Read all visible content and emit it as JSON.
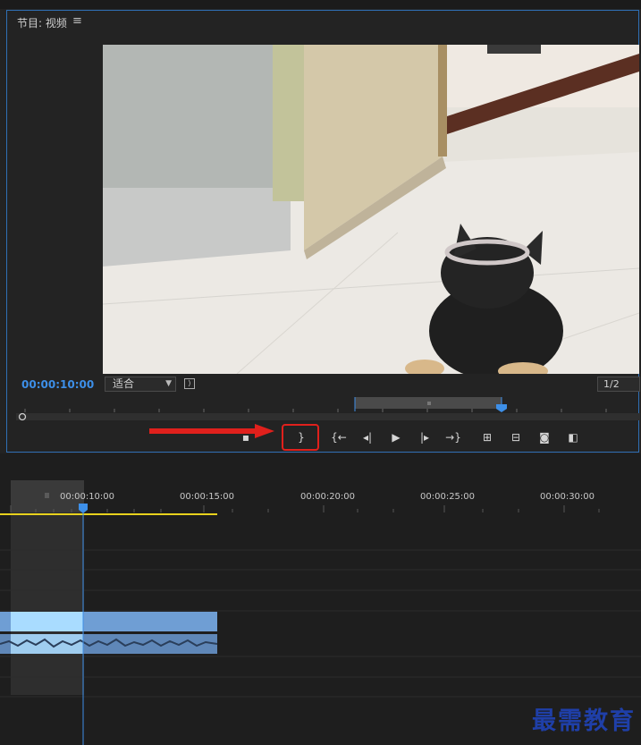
{
  "monitor": {
    "title": "节目: 视频",
    "menu_glyph": "≡",
    "timecode": "00:00:10:00",
    "fit_label": "适合",
    "resolution": "1/2"
  },
  "timeline": {
    "ruler_labels": [
      "00:00:10:00",
      "00:00:15:00",
      "00:00:20:00",
      "00:00:25:00",
      "00:00:30:00"
    ]
  },
  "controls": {
    "icons": [
      "mark-in-icon",
      "mark-out-icon",
      "go-to-in-icon",
      "step-back-icon",
      "play-icon",
      "step-forward-icon",
      "go-to-out-icon",
      "lift-icon",
      "extract-icon",
      "export-frame-icon",
      "compare-view-icon"
    ]
  },
  "colors": {
    "accent_blue": "#3d8fe8",
    "highlight_red": "#e0201c",
    "work_area_yellow": "#e8d21d",
    "clip_video": "#6f9ed4",
    "clip_selected": "#a9dcff",
    "watermark": "#1f3fa8"
  },
  "watermark": "最需教育"
}
